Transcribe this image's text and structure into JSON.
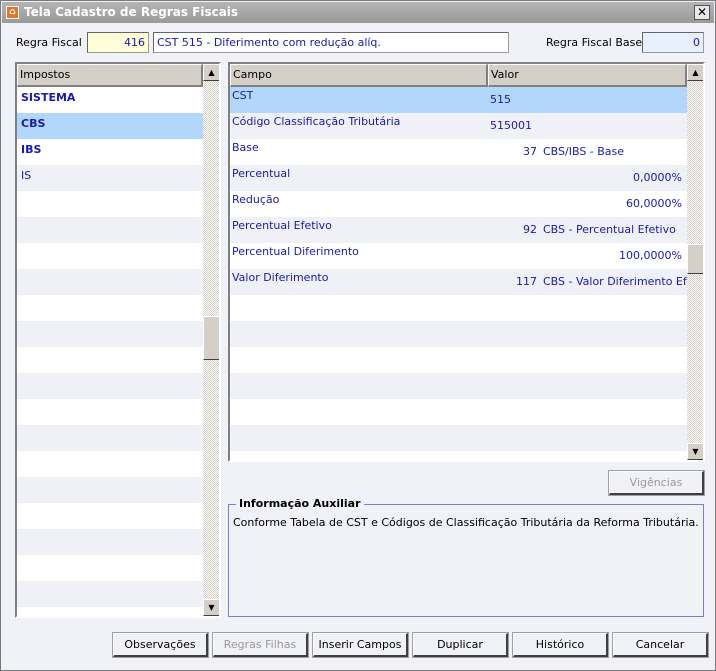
{
  "window": {
    "title": "Tela Cadastro de Regras Fiscais",
    "close_glyph": "✕"
  },
  "header": {
    "regra_fiscal_label": "Regra Fiscal",
    "regra_fiscal_code": "416",
    "regra_fiscal_desc": "CST 515 - Diferimento com redução alíq.",
    "regra_base_label": "Regra Fiscal Base",
    "regra_base_value": "0"
  },
  "impostos": {
    "header": "Impostos",
    "selected_index": 1,
    "items": [
      {
        "label": "SISTEMA",
        "bold": true
      },
      {
        "label": "CBS",
        "bold": true
      },
      {
        "label": "IBS",
        "bold": true
      },
      {
        "label": "IS",
        "bold": false
      }
    ]
  },
  "campos": {
    "headers": {
      "campo": "Campo",
      "valor": "Valor"
    },
    "selected_index": 0,
    "rows": [
      {
        "campo": "CST",
        "num": "",
        "valor": "515",
        "align": "left"
      },
      {
        "campo": "Código Classificação Tributária",
        "num": "",
        "valor": "515001",
        "align": "left"
      },
      {
        "campo": "Base",
        "num": "37",
        "valor": "CBS/IBS - Base",
        "align": "ref"
      },
      {
        "campo": "Percentual",
        "num": "",
        "valor": "0,0000%",
        "align": "right"
      },
      {
        "campo": "Redução",
        "num": "",
        "valor": "60,0000%",
        "align": "right"
      },
      {
        "campo": "Percentual Efetivo",
        "num": "92",
        "valor": "CBS - Percentual Efetivo",
        "align": "ref"
      },
      {
        "campo": "Percentual Diferimento",
        "num": "",
        "valor": "100,0000%",
        "align": "right"
      },
      {
        "campo": "Valor Diferimento",
        "num": "117",
        "valor": "CBS - Valor Diferimento Efetivo",
        "align": "ref"
      }
    ]
  },
  "vigencias_button": "Vigências",
  "info": {
    "title": "Informação Auxiliar",
    "text": "Conforme Tabela de CST e Códigos de Classificação Tributária da Reforma Tributária."
  },
  "buttons": {
    "observacoes": "Observações",
    "regras_filhas": "Regras Filhas",
    "inserir_campos": "Inserir Campos",
    "duplicar": "Duplicar",
    "historico": "Histórico",
    "cancelar": "Cancelar"
  },
  "colors": {
    "selected_row": "#b3d7fb",
    "text_blue": "#1a1aa8",
    "code_field": "#fffcd8",
    "base_field": "#e6f0ff"
  }
}
